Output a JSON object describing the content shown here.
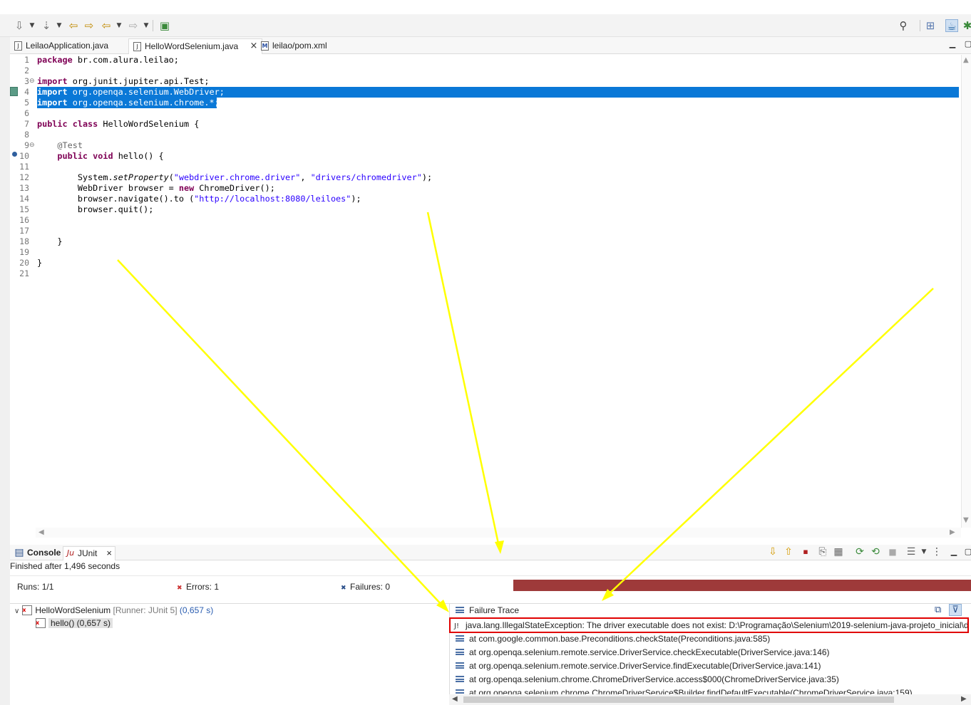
{
  "editor_tabs": [
    {
      "label": "LeilaoApplication.java",
      "icon": "java-file-icon"
    },
    {
      "label": "HelloWordSelenium.java",
      "icon": "java-file-icon",
      "active": true,
      "close": "×"
    },
    {
      "label": "leilao/pom.xml",
      "icon": "maven-file-icon"
    }
  ],
  "editor": {
    "line_numbers": [
      "1",
      "2",
      "3",
      "4",
      "5",
      "6",
      "7",
      "8",
      "9",
      "10",
      "11",
      "12",
      "13",
      "14",
      "15",
      "16",
      "17",
      "18",
      "19",
      "20",
      "21"
    ],
    "fold_markers": {
      "3": "⊖",
      "9": "⊖"
    },
    "selected_lines": [
      4,
      5
    ]
  },
  "bottom_view": {
    "tabs": [
      {
        "label": "Console",
        "icon": "console-icon"
      },
      {
        "label": "JUnit",
        "icon": "junit-icon",
        "close": "×"
      }
    ],
    "status": "Finished after 1,496 seconds",
    "runs_label": "Runs:",
    "runs_value": "1/1",
    "errors_label": "Errors:",
    "errors_value": "1",
    "failures_label": "Failures:",
    "failures_value": "0",
    "progress_color": "#9e3a3a",
    "tree": {
      "suite_name": "HelloWordSelenium",
      "suite_runner": "[Runner: JUnit 5]",
      "suite_time": "(0,657 s)",
      "test_name": "hello() (0,657 s)"
    },
    "failure_trace_title": "Failure Trace",
    "trace": [
      "java.lang.IllegalStateException: The driver executable does not exist: D:\\Programação\\Selenium\\2019-selenium-java-projeto_inicial\\dr",
      "at com.google.common.base.Preconditions.checkState(Preconditions.java:585)",
      "at org.openqa.selenium.remote.service.DriverService.checkExecutable(DriverService.java:146)",
      "at org.openqa.selenium.remote.service.DriverService.findExecutable(DriverService.java:141)",
      "at org.openqa.selenium.chrome.ChromeDriverService.access$000(ChromeDriverService.java:35)",
      "at org.openqa.selenium.chrome.ChromeDriverService$Builder.findDefaultExecutable(ChromeDriverService.java:159)"
    ]
  },
  "colors": {
    "selection": "#0a78d7",
    "keyword": "#7f0055",
    "string": "#2a00ff",
    "annotation_arrows": "#ffff00",
    "highlight_box": "#e00000"
  }
}
